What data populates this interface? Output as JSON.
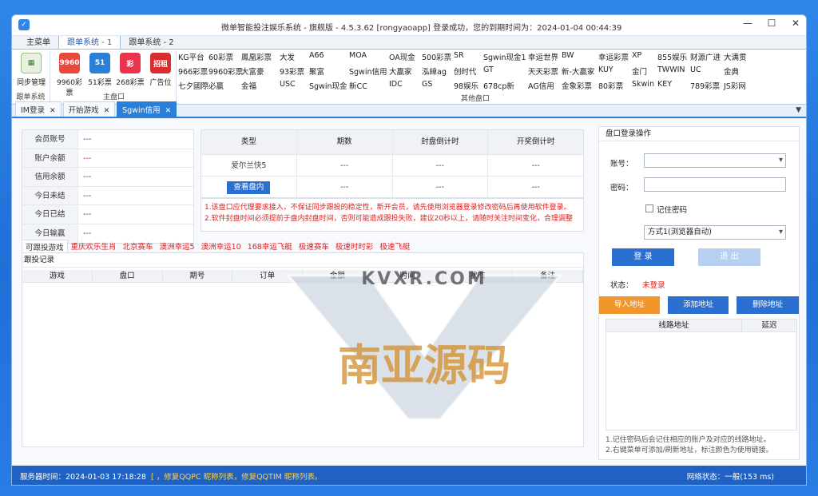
{
  "window": {
    "title": "微单智能投注娱乐系统 - 旗舰版 - 4.5.3.62    [rongyaoapp] 登录成功，您的到期时间为：2024-01-04 00:44:39"
  },
  "ribbon_tabs": [
    "主菜单",
    "跟单系统 - 1",
    "跟单系统 - 2"
  ],
  "ribbon": {
    "sync": {
      "label": "同步管理",
      "group": "跟单系统"
    },
    "main_buttons": [
      {
        "label": "9960彩票",
        "icon": "9960-logo-icon",
        "color": "#e84b3c",
        "glyph": "9960"
      },
      {
        "label": "51彩票",
        "icon": "51-logo-icon",
        "color": "#2a7fd8",
        "glyph": "51"
      },
      {
        "label": "268彩票",
        "icon": "268-logo-icon",
        "color": "#e8344c",
        "glyph": "彩"
      },
      {
        "label": "广告位",
        "icon": "ad-logo-icon",
        "color": "#d92c2c",
        "glyph": "招租"
      }
    ],
    "main_group": "主盘口",
    "other_group": "其他盘口",
    "platforms": [
      [
        "KG平台",
        "60彩票",
        "鳳凰彩票",
        "大发",
        "A66",
        "MOA",
        "OA现金",
        "500彩票",
        "SR",
        "Sgwin现金1",
        "幸运世界",
        "BW",
        "幸运彩票",
        "XP",
        "855娱乐",
        "财源广进",
        "大满贯"
      ],
      [
        "966彩票",
        "9960彩票",
        "大富豪",
        "93彩票",
        "聚富",
        "Sgwin信用",
        "大赢家",
        "泓緯ag",
        "创时代",
        "GT",
        "天天彩票",
        "新-大赢家",
        "KUY",
        "金门",
        "TWWIN",
        "UC",
        "金典"
      ],
      [
        "七夕國際",
        "必赢",
        "金福",
        "USC",
        "Sgwin现金",
        "新CC",
        "IDC",
        "GS",
        "98娱乐",
        "678cp新",
        "AG信用",
        "金象彩票",
        "80彩票",
        "Skwin",
        "KEY",
        "789彩票",
        "JS彩网"
      ]
    ]
  },
  "doc_tabs": [
    {
      "label": "IM登录",
      "closable": true
    },
    {
      "label": "开始游戏",
      "closable": true
    },
    {
      "label": "Sgwin信用",
      "closable": true,
      "active": true
    }
  ],
  "account": [
    {
      "key": "会员账号",
      "value": "---"
    },
    {
      "key": "账户余额",
      "value": "---",
      "red": true
    },
    {
      "key": "信用余额",
      "value": "---"
    },
    {
      "key": "今日未结",
      "value": "---"
    },
    {
      "key": "今日已结",
      "value": "---"
    },
    {
      "key": "今日输赢",
      "value": "---"
    }
  ],
  "info_table": {
    "headers": [
      "类型",
      "期数",
      "封盘倒计时",
      "开奖倒计时"
    ],
    "row1": [
      "爱尔兰快5",
      "---",
      "---",
      "---"
    ],
    "view_button": "查看盘内",
    "row2": [
      "---",
      "---",
      "---"
    ]
  },
  "notices": [
    "1.该盘口应代理要求接入，不保证同步跟投的稳定性，新开会员，请先使用浏览器登录修改密码后再使用软件登录。",
    "2.软件封盘时间必须提前于盘内封盘时间，否则可能造成跟投失败，建议20秒以上，请随时关注时间变化，合理调整"
  ],
  "game_tabs": [
    "可跟投游戏",
    "重庆欢乐生肖",
    "北京赛车",
    "澳洲幸运5",
    "澳洲幸运10",
    "168幸运飞艇",
    "极速赛车",
    "极速时时彩",
    "极速飞艇"
  ],
  "records": {
    "title": "跟投记录",
    "headers": [
      "游戏",
      "盘口",
      "期号",
      "订单",
      "金额",
      "时间",
      "状态",
      "备注"
    ]
  },
  "login_panel": {
    "title": "盘口登录操作",
    "account_label": "账号：",
    "password_label": "密码：",
    "remember_label": "记住密码",
    "mode_value": "方式1(浏览器自动)",
    "login_button": "登 录",
    "logout_button": "退 出",
    "status_label": "状态：",
    "status_value": "未登录",
    "import_button": "导入地址",
    "add_button": "添加地址",
    "delete_button": "删除地址",
    "addr_headers": [
      "线路地址",
      "延迟"
    ],
    "tips": [
      "1.记住密码后会记住相应的账户及对应的线路地址。",
      "2.右键菜单可添加/刷新地址，标注颜色为使用链接。"
    ]
  },
  "statusbar": {
    "server_time": "服务器时间：2024-01-03 17:18:28",
    "marquee": "[ ，修复QQPC  昵称列表，修复QQTIM  昵称列表。",
    "network": "网络状态：一般(153 ms)"
  },
  "watermark": {
    "top": "KVXR.COM",
    "main": "南亚源码"
  },
  "colors": {
    "accent": "#2b7fd9",
    "red": "#e02020",
    "orange": "#f0962a",
    "blue_btn": "#2b6fd0"
  }
}
